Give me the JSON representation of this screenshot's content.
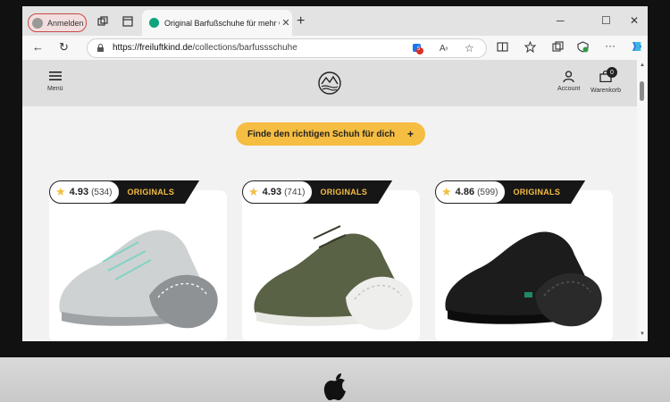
{
  "browser": {
    "profile_label": "Anmelden",
    "tab_title": "Original Barfußschuhe für mehr G",
    "url_host": "https://freiluftkind.de",
    "url_path": "/collections/barfussschuhe",
    "extension_badge_count": "5"
  },
  "site": {
    "menu_label": "Menü",
    "account_label": "Account",
    "cart_label": "Warenkorb",
    "cart_count": "0",
    "cta_label": "Finde den richtigen Schuh für dich",
    "cta_icon": "+"
  },
  "products": [
    {
      "rating": "4.93",
      "reviews": "(534)",
      "badge": "ORIGINALS",
      "color": "#cfd2d3"
    },
    {
      "rating": "4.93",
      "reviews": "(741)",
      "badge": "ORIGINALS",
      "color": "#5a6246"
    },
    {
      "rating": "4.86",
      "reviews": "(599)",
      "badge": "ORIGINALS",
      "color": "#1c1c1c"
    }
  ],
  "colors": {
    "accent": "#f5bd41",
    "dark": "#161616"
  }
}
